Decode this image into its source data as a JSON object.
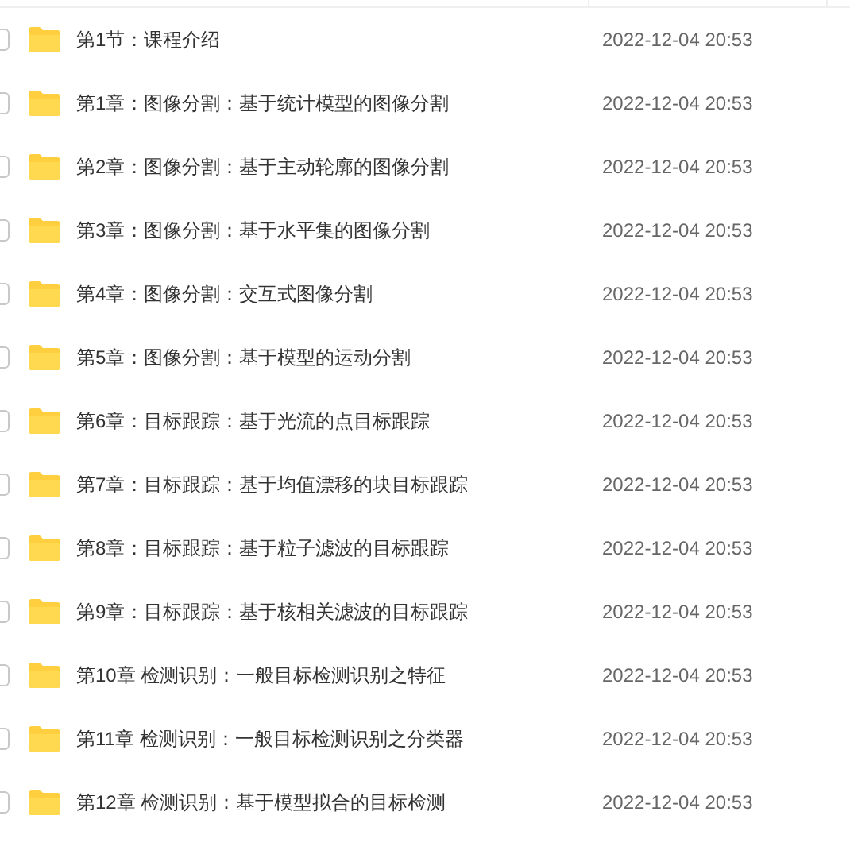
{
  "files": [
    {
      "name": "第1节：课程介绍",
      "modified": "2022-12-04 20:53",
      "checked": false
    },
    {
      "name": "第1章：图像分割：基于统计模型的图像分割",
      "modified": "2022-12-04 20:53",
      "checked": false
    },
    {
      "name": "第2章：图像分割：基于主动轮廓的图像分割",
      "modified": "2022-12-04 20:53",
      "checked": false
    },
    {
      "name": "第3章：图像分割：基于水平集的图像分割",
      "modified": "2022-12-04 20:53",
      "checked": false
    },
    {
      "name": "第4章：图像分割：交互式图像分割",
      "modified": "2022-12-04 20:53",
      "checked": false
    },
    {
      "name": "第5章：图像分割：基于模型的运动分割",
      "modified": "2022-12-04 20:53",
      "checked": false
    },
    {
      "name": "第6章：目标跟踪：基于光流的点目标跟踪",
      "modified": "2022-12-04 20:53",
      "checked": false
    },
    {
      "name": "第7章：目标跟踪：基于均值漂移的块目标跟踪",
      "modified": "2022-12-04 20:53",
      "checked": false
    },
    {
      "name": "第8章：目标跟踪：基于粒子滤波的目标跟踪",
      "modified": "2022-12-04 20:53",
      "checked": false
    },
    {
      "name": "第9章：目标跟踪：基于核相关滤波的目标跟踪",
      "modified": "2022-12-04 20:53",
      "checked": false
    },
    {
      "name": "第10章 检测识别：一般目标检测识别之特征",
      "modified": "2022-12-04 20:53",
      "checked": false
    },
    {
      "name": "第11章 检测识别：一般目标检测识别之分类器",
      "modified": "2022-12-04 20:53",
      "checked": false
    },
    {
      "name": "第12章 检测识别：基于模型拟合的目标检测",
      "modified": "2022-12-04 20:53",
      "checked": false
    }
  ]
}
